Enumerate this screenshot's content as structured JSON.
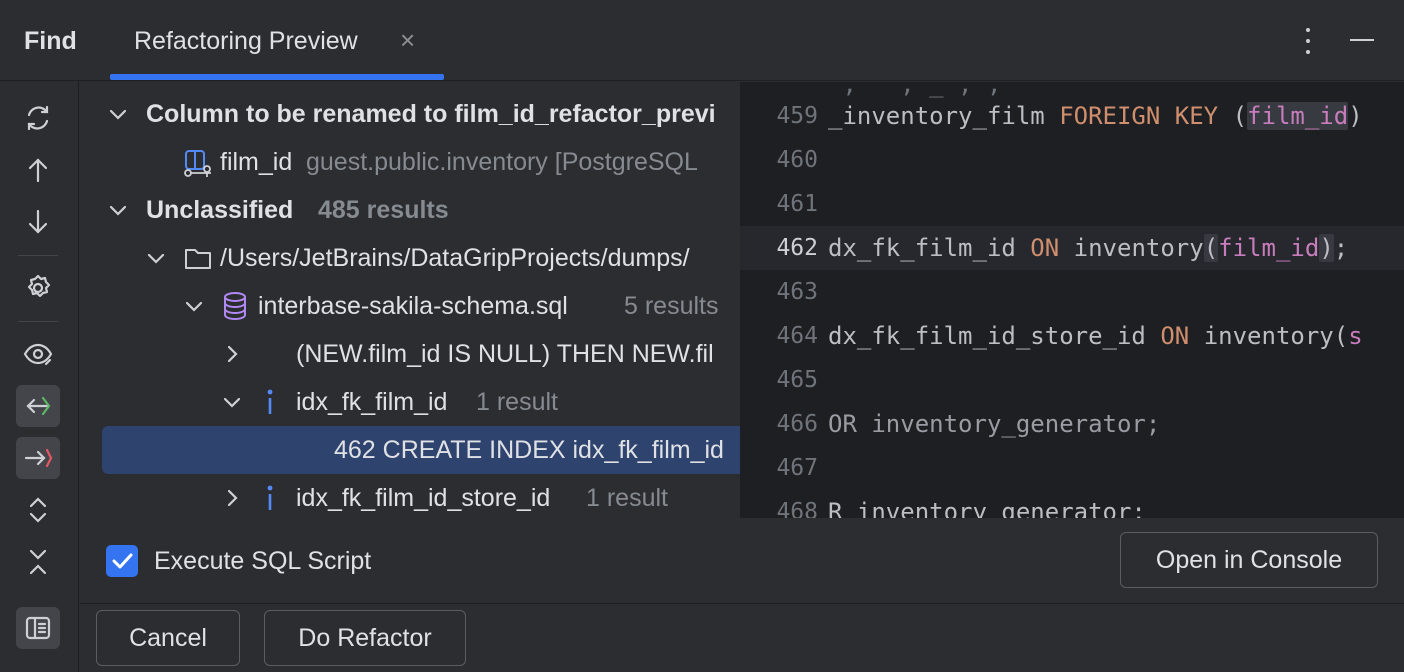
{
  "header": {
    "find_label": "Find",
    "tab_label": "Refactoring Preview",
    "tab_close": "×"
  },
  "tree": {
    "group1_title": "Column to be renamed to film_id_refactor_previ",
    "item_film_id": "film_id",
    "item_film_id_location": "guest.public.inventory [PostgreSQL",
    "group2_title": "Unclassified",
    "group2_count": "485 results",
    "folder_path": "/Users/JetBrains/DataGripProjects/dumps/",
    "file_name": "interbase-sakila-schema.sql",
    "file_count": "5 results",
    "usage_text": "(NEW.film_id IS NULL) THEN NEW.fil",
    "index1_name": "idx_fk_film_id",
    "index1_count": "1 result",
    "selected_text": "462 CREATE  INDEX idx_fk_film_id",
    "index2_name": "idx_fk_film_id_store_id",
    "index2_count": "1 result"
  },
  "editor": {
    "lines": [
      {
        "num": "459"
      },
      {
        "num": "460"
      },
      {
        "num": "461"
      },
      {
        "num": "462"
      },
      {
        "num": "463"
      },
      {
        "num": "464"
      },
      {
        "num": "465"
      },
      {
        "num": "466"
      },
      {
        "num": "467"
      },
      {
        "num": "468"
      }
    ],
    "l459_a": "_inventory_film ",
    "l459_kw": "FOREIGN KEY",
    "l459_b": " (",
    "l459_id": "film_id",
    "l459_c": ")",
    "l462_a": "dx_fk_film_id ",
    "l462_kw": "ON",
    "l462_b": " inventory",
    "l462_p1": "(",
    "l462_id": "film_id",
    "l462_p2": ")",
    "l462_c": ";",
    "l464_a": "dx_fk_film_id_store_id ",
    "l464_kw": "ON",
    "l464_b": " inventory(",
    "l464_id": "s",
    "l466": "OR inventory_generator;",
    "l468": "R inventory_generator;"
  },
  "footer": {
    "execute_label": "Execute SQL Script",
    "execute_checked": true,
    "open_console": "Open in Console",
    "cancel": "Cancel",
    "do_refactor": "Do Refactor"
  },
  "colors": {
    "accent": "#3574f0",
    "selection": "#2e436e",
    "keyword": "#cf8e6d",
    "identifier": "#c77dbb"
  }
}
